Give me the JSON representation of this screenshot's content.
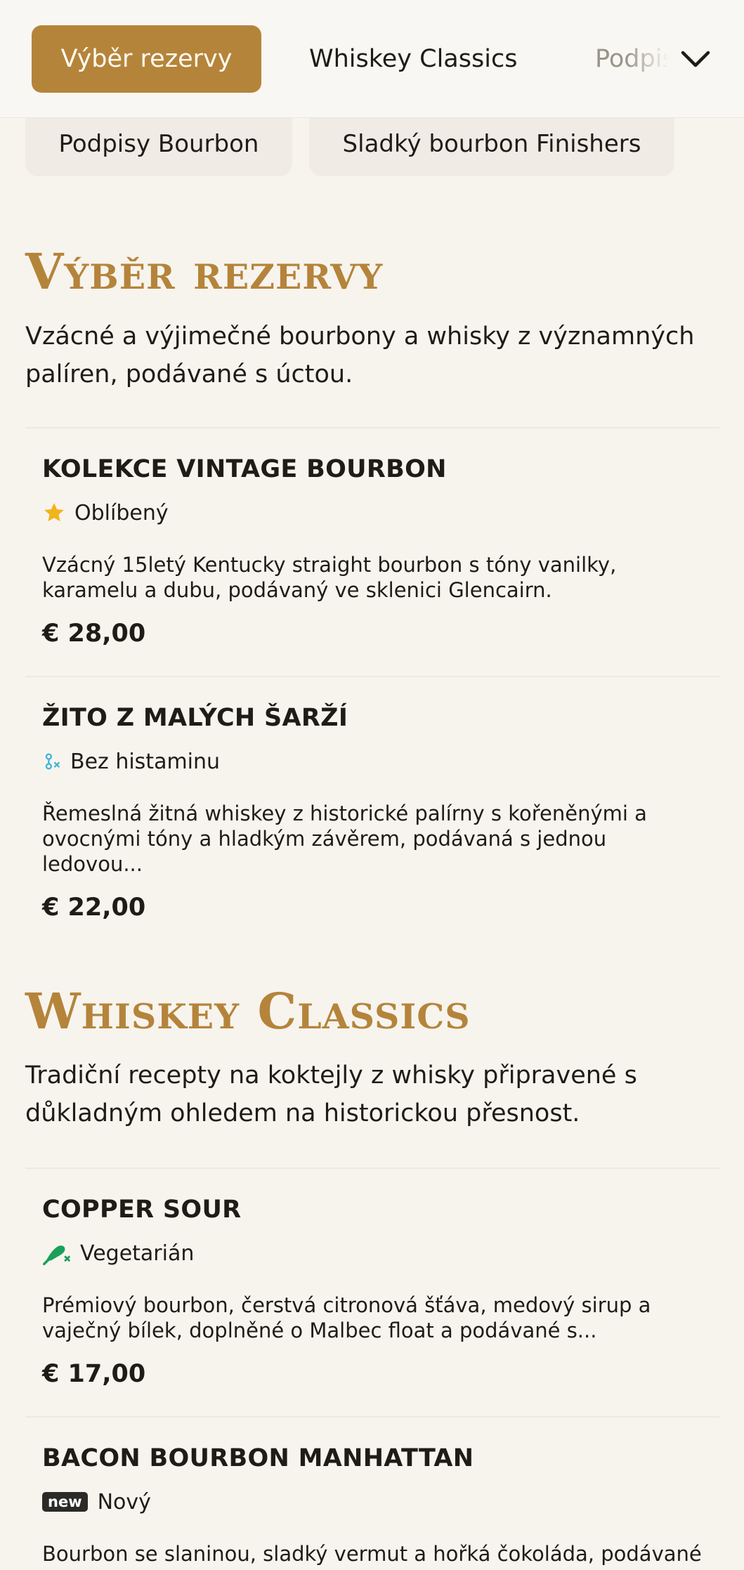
{
  "nav": {
    "tabs": [
      {
        "label": "Výběr rezervy",
        "active": true
      },
      {
        "label": "Whiskey Classics",
        "active": false
      },
      {
        "label": "Podpisy Bourbon",
        "active": false
      }
    ],
    "more_icon": "chevron-down-icon",
    "chips": [
      "Podpisy Bourbon",
      "Sladký bourbon Finishers"
    ]
  },
  "accent_color": "#b5843b",
  "sections": [
    {
      "title": "Výběr rezervy",
      "description": "Vzácné a výjimečné bourbony a whisky z významných palíren, podávané s úctou.",
      "items": [
        {
          "name": "Kolekce Vintage Bourbon",
          "tag": "Oblíbený",
          "tag_icon": "star-icon",
          "description": "Vzácný 15letý Kentucky straight bourbon s tóny vanilky, karamelu a dubu, podávaný ve sklenici Glencairn.",
          "price": "€ 28,00"
        },
        {
          "name": "Žito z malých šarží",
          "tag": "Bez histaminu",
          "tag_icon": "histamine-free-icon",
          "description": "Řemeslná žitná whiskey z historické palírny s kořeněnými a ovocnými tóny a hladkým závěrem, podávaná s jednou ledovou...",
          "price": "€ 22,00"
        }
      ]
    },
    {
      "title": "Whiskey Classics",
      "description": "Tradiční recepty na koktejly z whisky připravené s důkladným ohledem na historickou přesnost.",
      "items": [
        {
          "name": "Copper Sour",
          "tag": "Vegetarián",
          "tag_icon": "vegetarian-icon",
          "description": "Prémiový bourbon, čerstvá citronová šťáva, medový sirup a vaječný bílek, doplněné o Malbec float a podávané s...",
          "price": "€ 17,00"
        },
        {
          "name": "Bacon Bourbon Manhattan",
          "tag_badge": "new",
          "tag": "Nový",
          "tag_icon": "new-badge-icon",
          "description": "Bourbon se slaninou, sladký vermut a hořká čokoláda, podávané"
        }
      ]
    }
  ]
}
